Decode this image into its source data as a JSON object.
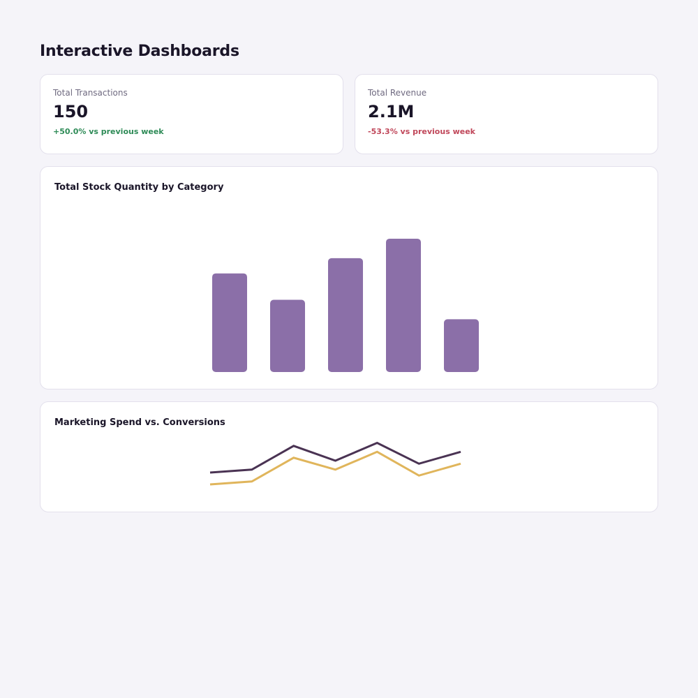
{
  "page": {
    "title": "Interactive Dashboards"
  },
  "kpis": [
    {
      "label": "Total Transactions",
      "value": "150",
      "delta": "+50.0% vs previous week",
      "trend": "up"
    },
    {
      "label": "Total Revenue",
      "value": "2.1M",
      "delta": "-53.3% vs previous week",
      "trend": "down"
    }
  ],
  "colors": {
    "background": "#f5f4f9",
    "bar": "#8b6fa8",
    "positive": "#2e8b57",
    "negative": "#c0475a",
    "series_dark": "#4a3353",
    "series_gold": "#e0b55b"
  },
  "charts": {
    "stock": {
      "title": "Total Stock Quantity by Category"
    },
    "marketing": {
      "title": "Marketing Spend vs. Conversions"
    }
  },
  "chart_data": [
    {
      "type": "bar",
      "title": "Total Stock Quantity by Category",
      "categories": [
        "",
        "",
        "",
        "",
        ""
      ],
      "values": [
        71,
        52,
        82,
        96,
        38
      ],
      "ylim": [
        0,
        100
      ],
      "grid": false,
      "color": "#8b6fa8"
    },
    {
      "type": "line",
      "title": "Marketing Spend vs. Conversions",
      "x": [
        1,
        2,
        3,
        4,
        5,
        6,
        7
      ],
      "ylim": [
        0,
        100
      ],
      "grid": false,
      "series": [
        {
          "values": [
            20,
            25,
            65,
            45,
            75,
            35,
            55
          ],
          "color": "#e0b55b"
        },
        {
          "values": [
            40,
            45,
            85,
            60,
            90,
            55,
            75
          ],
          "color": "#4a3353"
        }
      ]
    }
  ]
}
